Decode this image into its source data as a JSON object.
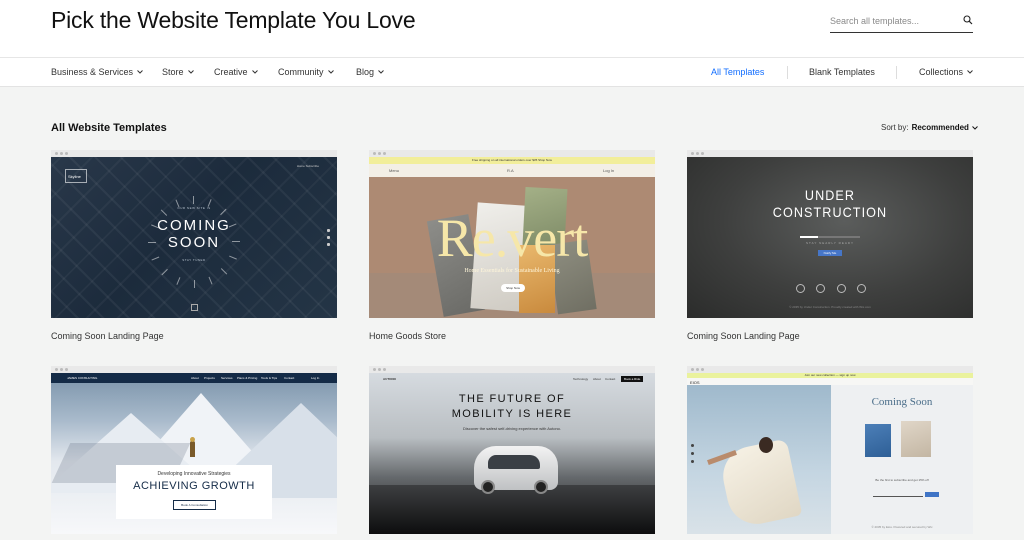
{
  "header": {
    "title": "Pick the Website Template You Love",
    "search_placeholder": "Search all templates..."
  },
  "nav": {
    "left": [
      {
        "label": "Business & Services"
      },
      {
        "label": "Store"
      },
      {
        "label": "Creative"
      },
      {
        "label": "Community"
      },
      {
        "label": "Blog"
      }
    ],
    "right": [
      {
        "label": "All Templates",
        "active": true
      },
      {
        "label": "Blank Templates",
        "active": false
      },
      {
        "label": "Collections",
        "active": false
      }
    ]
  },
  "main": {
    "section_title": "All Website Templates",
    "sort_label": "Sort by:",
    "sort_value": "Recommended"
  },
  "colors": {
    "accent": "#116dff",
    "page_bg": "#f3f4f3"
  },
  "templates": [
    {
      "name": "Coming Soon Landing Page",
      "thumb": {
        "logo": "Skyline",
        "menu": "Home   Subscribe",
        "kicker": "OUR NEW SITE IS",
        "heading_1": "COMING",
        "heading_2": "SOON",
        "footer": "STAY TUNED"
      }
    },
    {
      "name": "Home Goods Store",
      "thumb": {
        "promo": "Free shipping on all international orders over $35  Shop Now",
        "menu_left": "Menu",
        "logo": "R.A",
        "menu_right": "Log In",
        "brand": "Re.vert",
        "tagline": "Home Essentials for Sustainable Living",
        "button": "Shop Now"
      }
    },
    {
      "name": "Coming Soon Landing Page",
      "thumb": {
        "heading_1": "UNDER",
        "heading_2": "CONSTRUCTION",
        "caption": "STAY NEARLY READY",
        "button": "Notify Me",
        "footer": "© 2035 by Under Construction. Proudly created with Wix.com",
        "progress": 0.3
      }
    },
    {
      "name": "",
      "thumb": {
        "logo": "JAMES CONSULTING",
        "menu": [
          "About",
          "Projects",
          "Services",
          "Plans & Pricing",
          "Tools & Tips",
          "Contact"
        ],
        "login": "Log In",
        "kicker": "Developing Innovative Strategies",
        "heading": "ACHIEVING GROWTH",
        "button": "Book A Consultation"
      }
    },
    {
      "name": "",
      "thumb": {
        "logo": "AUTONO",
        "menu": [
          "Technology",
          "About",
          "Contact"
        ],
        "cta": "Book a Ride",
        "heading_1": "THE FUTURE OF",
        "heading_2": "MOBILITY IS HERE",
        "sub": "Discover the safest self-driving experience with Autono."
      }
    },
    {
      "name": "",
      "thumb": {
        "promo": "Join our new collection — sign up now",
        "logo": "EIOS",
        "heading": "Coming Soon",
        "sub": "Be the first to subscribe and get 15% off",
        "footer": "© 2035 by Eios. Powered and secured by Wix"
      }
    }
  ]
}
